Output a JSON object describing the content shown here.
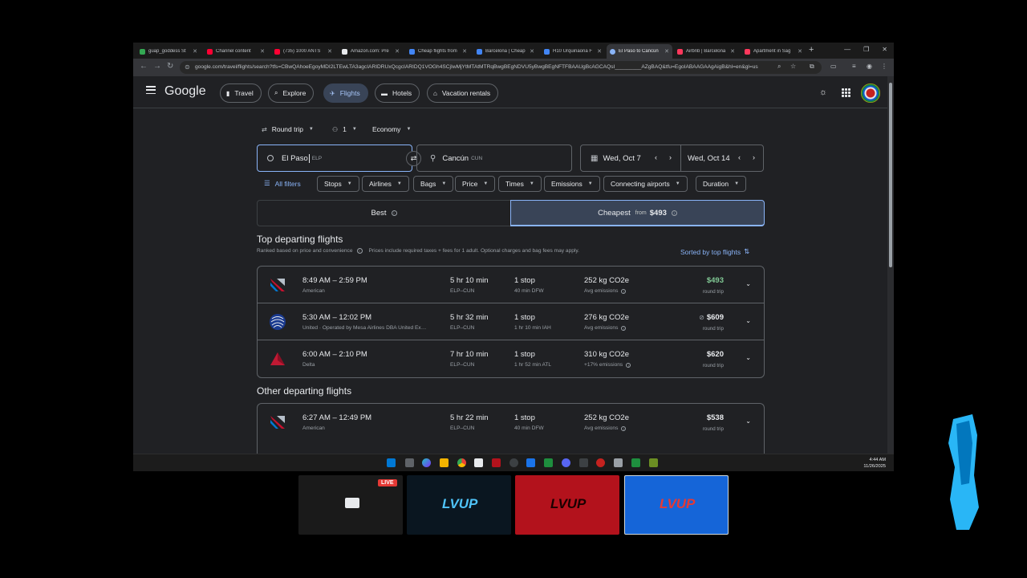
{
  "browser": {
    "tabs": [
      {
        "title": "guap_goddess St",
        "color": "#34a853"
      },
      {
        "title": "Channel content",
        "color": "#ff0033"
      },
      {
        "title": "(735) 1000 ANTS",
        "color": "#ff0033"
      },
      {
        "title": "Amazon.com: Pre",
        "color": "#e8eaed"
      },
      {
        "title": "Cheap flights from",
        "color": "#4285f4"
      },
      {
        "title": "Barcelona | Cheap",
        "color": "#4285f4"
      },
      {
        "title": "H10 Urquinaona F",
        "color": "#4285f4"
      },
      {
        "title": "El Paso to Cancún",
        "color": "#8ab4f8"
      },
      {
        "title": "Airbnb | Barcelona",
        "color": "#ff385c"
      },
      {
        "title": "Apartment in Sag",
        "color": "#ff385c"
      }
    ],
    "url": "google.com/travel/flights/search?tfs=CBwQAhoeEgoyMDI2LTEwLTA3agcIARIDRUxQcgcIARIDQ1VOGh4SCjIwMjYtMTAtMTRqBwgBEgNDVU5yBwgBEgNFTFBAAUgBcAGCAQsI_________AZgBAQ&tfu=EgoIABAAGAAgAigB&hl=en&gl=us"
  },
  "header": {
    "logo": "Google",
    "nav": [
      "Travel",
      "Explore",
      "Flights",
      "Hotels",
      "Vacation rentals"
    ]
  },
  "search": {
    "trip_type": "Round trip",
    "passengers": "1",
    "cabin": "Economy",
    "from_city": "El Paso",
    "from_code": "ELP",
    "to_city": "Cancún",
    "to_code": "CUN",
    "depart": "Wed, Oct 7",
    "return": "Wed, Oct 14"
  },
  "filters": {
    "all": "All filters",
    "chips": [
      "Stops",
      "Airlines",
      "Bags",
      "Price",
      "Times",
      "Emissions",
      "Connecting airports",
      "Duration"
    ]
  },
  "sort_tabs": {
    "best": "Best",
    "cheapest": "Cheapest",
    "from_label": "from",
    "from_price": "$493"
  },
  "results": {
    "top_title": "Top departing flights",
    "ranked_note": "Ranked based on price and convenience",
    "price_note": "Prices include required taxes + fees for 1 adult. Optional charges and bag fees may apply.",
    "sorted_by": "Sorted by top flights",
    "other_title": "Other departing flights",
    "top_flights": [
      {
        "times": "8:49 AM – 2:59 PM",
        "carrier": "American",
        "duration": "5 hr 10 min",
        "route": "ELP–CUN",
        "stops": "1 stop",
        "layover": "40 min DFW",
        "co2": "252 kg CO2e",
        "emissions": "Avg emissions",
        "price": "$493",
        "price_type": "round trip",
        "logo": "american"
      },
      {
        "times": "5:30 AM – 12:02 PM",
        "carrier": "United · Operated by Mesa Airlines DBA United Ex…",
        "duration": "5 hr 32 min",
        "route": "ELP–CUN",
        "stops": "1 stop",
        "layover": "1 hr 10 min IAH",
        "co2": "276 kg CO2e",
        "emissions": "Avg emissions",
        "price": "$609",
        "price_type": "round trip",
        "logo": "united"
      },
      {
        "times": "6:00 AM – 2:10 PM",
        "carrier": "Delta",
        "duration": "7 hr 10 min",
        "route": "ELP–CUN",
        "stops": "1 stop",
        "layover": "1 hr 52 min ATL",
        "co2": "310 kg CO2e",
        "emissions": "+17% emissions",
        "price": "$620",
        "price_type": "round trip",
        "logo": "delta"
      }
    ],
    "other_flights": [
      {
        "times": "6:27 AM – 12:49 PM",
        "carrier": "American",
        "duration": "5 hr 22 min",
        "route": "ELP–CUN",
        "stops": "1 stop",
        "layover": "40 min DFW",
        "co2": "252 kg CO2e",
        "emissions": "Avg emissions",
        "price": "$538",
        "price_type": "round trip",
        "logo": "american"
      }
    ]
  },
  "taskbar": {
    "time": "4:44 AM",
    "date": "11/26/2025"
  },
  "stream": {
    "live": "LIVE",
    "brand": "LVUP"
  }
}
